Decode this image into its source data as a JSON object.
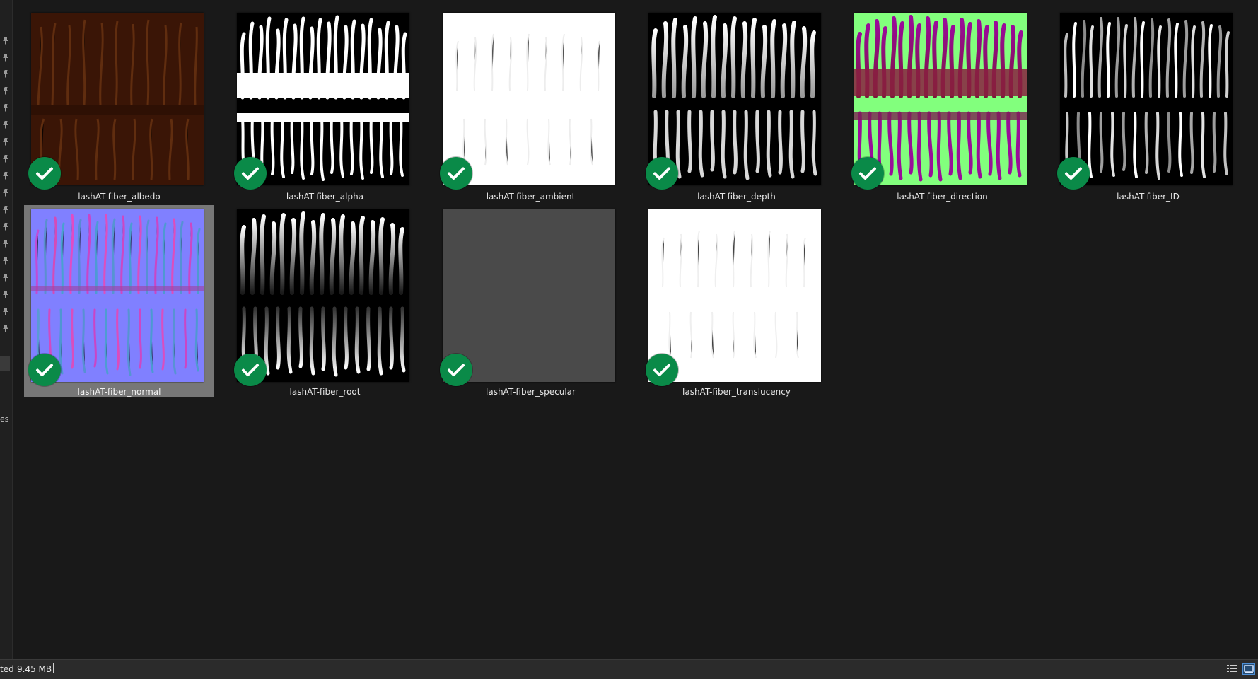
{
  "left_strip": {
    "pin_icon": "pin-icon",
    "truncated_label": "es"
  },
  "files": [
    {
      "name": "lashAT-fiber_albedo",
      "status": "check-icon"
    },
    {
      "name": "lashAT-fiber_alpha",
      "status": "check-icon"
    },
    {
      "name": "lashAT-fiber_ambient",
      "status": "check-icon"
    },
    {
      "name": "lashAT-fiber_depth",
      "status": "check-icon"
    },
    {
      "name": "lashAT-fiber_direction",
      "status": "check-icon"
    },
    {
      "name": "lashAT-fiber_ID",
      "status": "check-icon"
    },
    {
      "name": "lashAT-fiber_normal",
      "status": "check-icon",
      "selected": true
    },
    {
      "name": "lashAT-fiber_root",
      "status": "check-icon"
    },
    {
      "name": "lashAT-fiber_specular",
      "status": "check-icon"
    },
    {
      "name": "lashAT-fiber_translucency",
      "status": "check-icon"
    }
  ],
  "status_bar": {
    "selection_text": "ted",
    "size": "9.45 MB",
    "view_details_icon": "details-view-icon",
    "view_large_icon": "large-icons-view-icon"
  },
  "colors": {
    "sync_check": "#0a8a48",
    "selection": "#777777",
    "background": "#191919"
  }
}
